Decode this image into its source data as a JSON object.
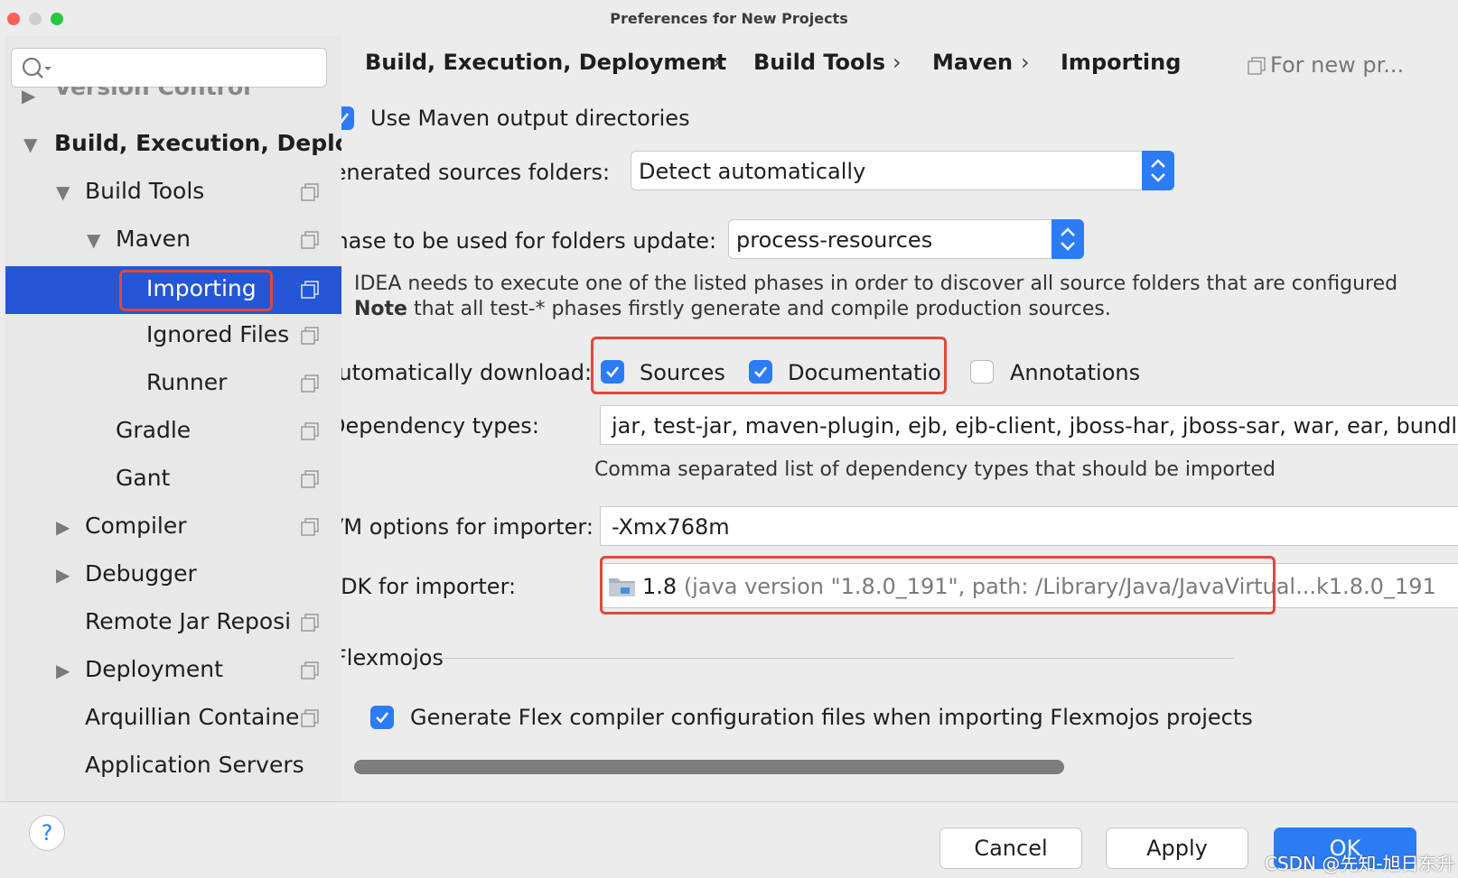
{
  "window": {
    "title": "Preferences for New Projects"
  },
  "sidebar": {
    "search_placeholder": "",
    "items": [
      {
        "label": "Version Control"
      },
      {
        "label": "Build, Execution, Deplo"
      },
      {
        "label": "Build Tools"
      },
      {
        "label": "Maven"
      },
      {
        "label": "Importing"
      },
      {
        "label": "Ignored Files"
      },
      {
        "label": "Runner"
      },
      {
        "label": "Gradle"
      },
      {
        "label": "Gant"
      },
      {
        "label": "Compiler"
      },
      {
        "label": "Debugger"
      },
      {
        "label": "Remote Jar Reposi"
      },
      {
        "label": "Deployment"
      },
      {
        "label": "Arquillian Containe"
      },
      {
        "label": "Application Servers"
      }
    ]
  },
  "breadcrumb": {
    "items": [
      "Build, Execution, Deployment",
      "Build Tools",
      "Maven",
      "Importing"
    ],
    "separator": "›",
    "scope": "For new pr..."
  },
  "settings": {
    "use_output_dirs": {
      "label": "Use Maven output directories",
      "checked": true
    },
    "generated_sources": {
      "label": "Generated sources folders:",
      "value": "Detect automatically"
    },
    "phase": {
      "label": "Phase to be used for folders update:",
      "value": "process-resources"
    },
    "phase_note": {
      "line1": "IDEA needs to execute one of the listed phases in order to discover all source folders that are configured",
      "note_bold": "Note",
      "line2_rest": " that all test-* phases firstly generate and compile production sources."
    },
    "auto_download": {
      "label": "Automatically download:",
      "sources": "Sources",
      "documentation": "Documentation",
      "annotations": "Annotations"
    },
    "dependency_types": {
      "label": "Dependency types:",
      "value": "jar, test-jar, maven-plugin, ejb, ejb-client, jboss-har, jboss-sar, war, ear, bundle",
      "hint": "Comma separated list of dependency types that should be imported"
    },
    "vm_options": {
      "label": "VM options for importer:",
      "value": "-Xmx768m"
    },
    "jdk": {
      "label": "JDK for importer:",
      "version": "1.8",
      "detail": "(java version \"1.8.0_191\", path: /Library/Java/JavaVirtual...k1.8.0_191"
    },
    "flexmojos": {
      "section": "Flexmojos",
      "generate_label": "Generate Flex compiler configuration files when importing Flexmojos projects"
    }
  },
  "buttons": {
    "help": "?",
    "cancel": "Cancel",
    "apply": "Apply",
    "ok": "OK"
  },
  "watermark": "CSDN @先知-旭日东升",
  "colors": {
    "accent": "#2b7cf5",
    "selection": "#2456d6",
    "highlight_box": "#e0483c"
  }
}
